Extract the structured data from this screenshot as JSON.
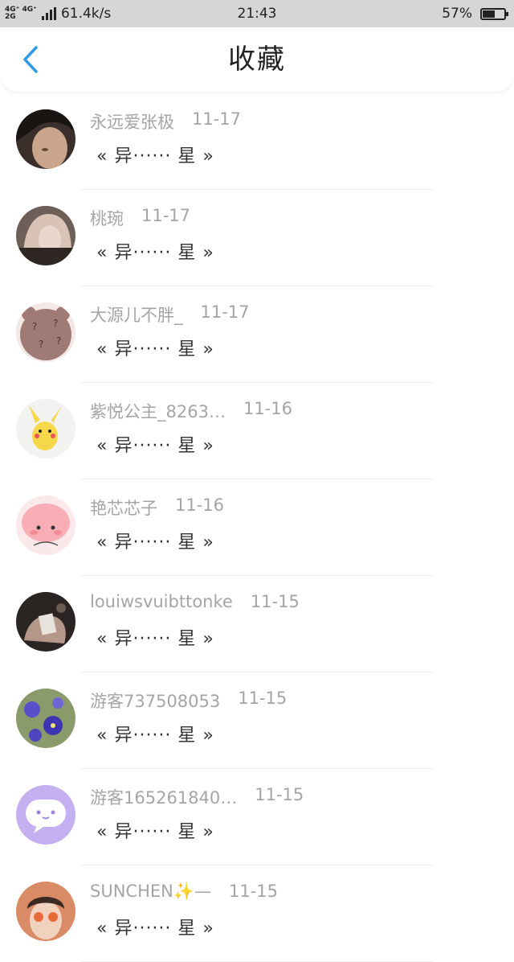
{
  "status": {
    "net_top": "4G⁺ 4G⁺",
    "net_bottom": "2G",
    "speed": "61.4k/s",
    "time": "21:43",
    "battery": "57%",
    "battery_level": 0.57
  },
  "header": {
    "title": "收藏"
  },
  "items": [
    {
      "nick": "永远爱张极",
      "date": "11-17",
      "title": "« 异······ 星 »",
      "avatar": "dark-portrait"
    },
    {
      "nick": "桃琬",
      "date": "11-17",
      "title": "« 异······ 星 »",
      "avatar": "blonde-portrait"
    },
    {
      "nick": "大源儿不胖_",
      "date": "11-17",
      "title": "« 异······ 星 »",
      "avatar": "cookie-bear"
    },
    {
      "nick": "紫悦公主_8263…",
      "date": "11-16",
      "title": "« 异······ 星 »",
      "avatar": "pikachu"
    },
    {
      "nick": "艳芯芯子",
      "date": "11-16",
      "title": "« 异······ 星 »",
      "avatar": "pink-cartoon"
    },
    {
      "nick": "louiwsvuibttonke",
      "date": "11-15",
      "title": "« 异······ 星 »",
      "avatar": "hand-photo"
    },
    {
      "nick": "游客737508053",
      "date": "11-15",
      "title": "« 异······ 星 »",
      "avatar": "purple-flowers"
    },
    {
      "nick": "游客165261840…",
      "date": "11-15",
      "title": "« 异······ 星 »",
      "avatar": "chat-bubble"
    },
    {
      "nick": "SUNCHEN✨—",
      "date": "11-15",
      "title": "« 异······ 星 »",
      "avatar": "sunglasses"
    }
  ]
}
